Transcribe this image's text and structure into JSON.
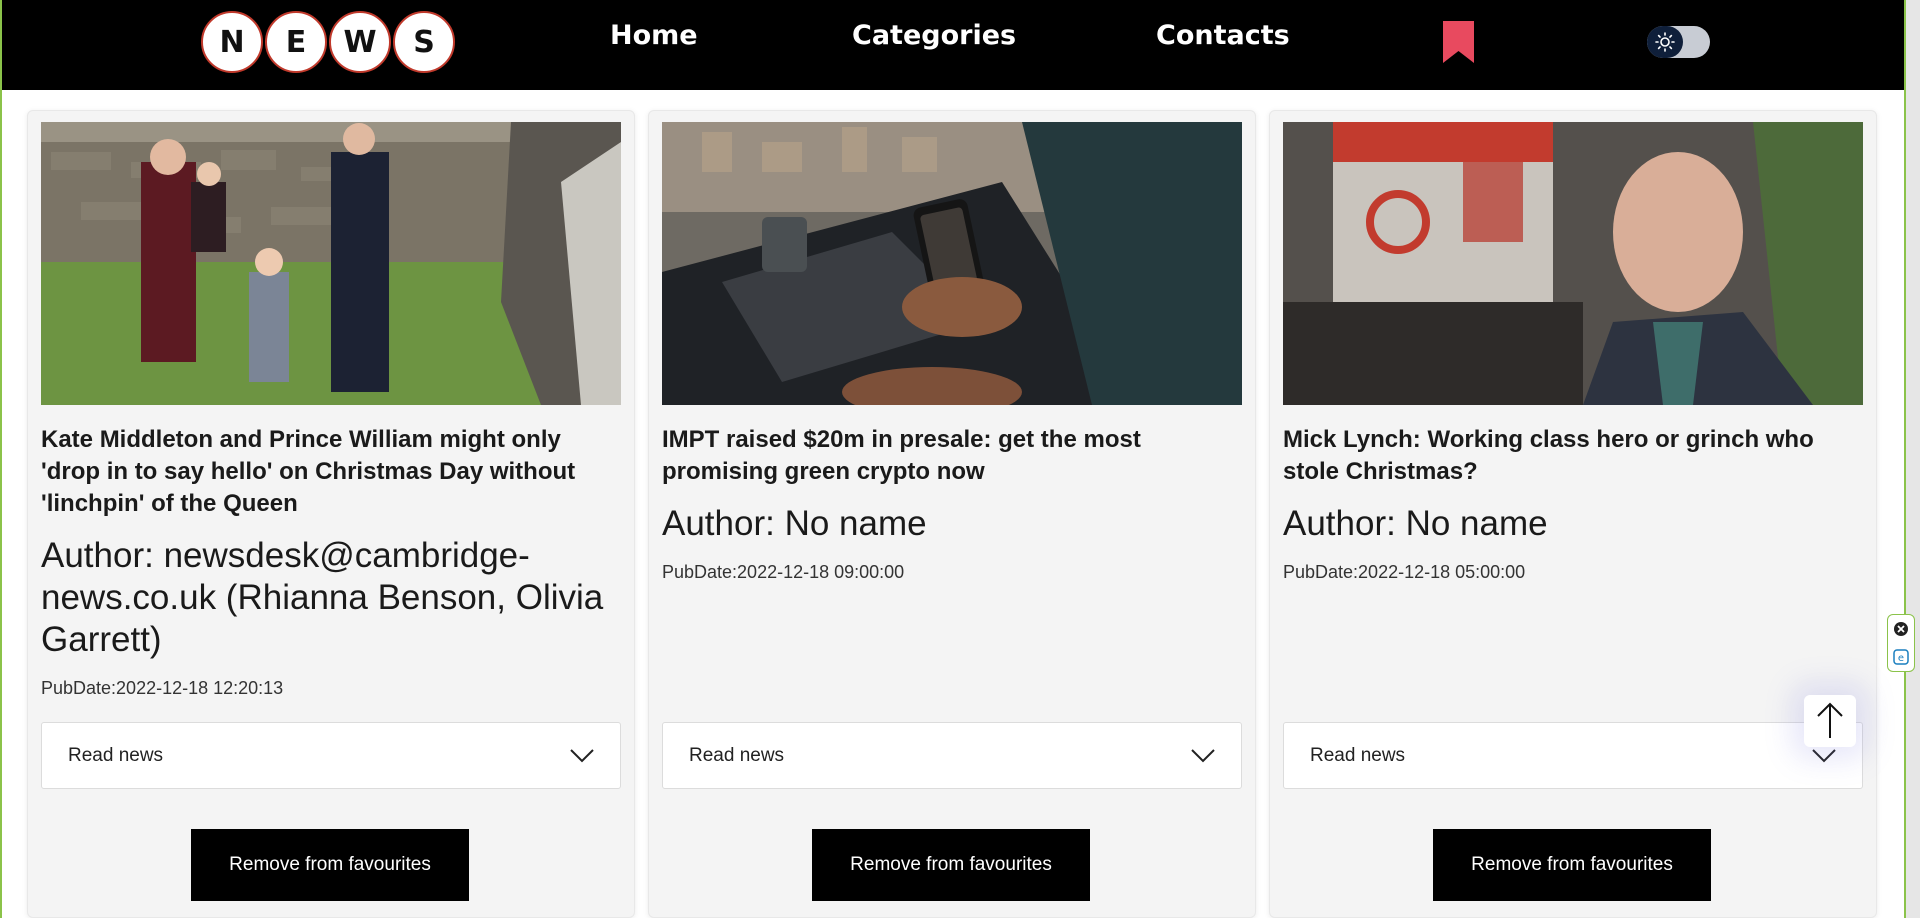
{
  "logo": {
    "letters": [
      "N",
      "E",
      "W",
      "S"
    ]
  },
  "nav": {
    "home": "Home",
    "categories": "Categories",
    "contacts": "Contacts"
  },
  "icons": {
    "bookmark": "bookmark-icon",
    "theme": "sun-icon",
    "scroll_top": "arrow-up-icon",
    "dropdown": "chevron-down-icon"
  },
  "colors": {
    "header_bg": "#000000",
    "accent_red": "#e84a5f",
    "card_bg": "#f4f4f4",
    "button_bg": "#000000"
  },
  "cards": [
    {
      "title": "Kate Middleton and Prince William might only 'drop in to say hello' on Christmas Day without 'linchpin' of the Queen",
      "author": "Author: newsdesk@cambridge-news.co.uk (Rhianna Benson, Olivia Garrett)",
      "pubdate": "PubDate:2022-12-18 12:20:13",
      "read_label": "Read news",
      "remove_label": "Remove from favourites"
    },
    {
      "title": "IMPT raised $20m in presale: get the most promising green crypto now",
      "author": "Author: No name",
      "pubdate": "PubDate:2022-12-18 09:00:00",
      "read_label": "Read news",
      "remove_label": "Remove from favourites"
    },
    {
      "title": "Mick Lynch: Working class hero or grinch who stole Christmas?",
      "author": "Author: No name",
      "pubdate": "PubDate:2022-12-18 05:00:00",
      "read_label": "Read news",
      "remove_label": "Remove from favourites"
    }
  ]
}
